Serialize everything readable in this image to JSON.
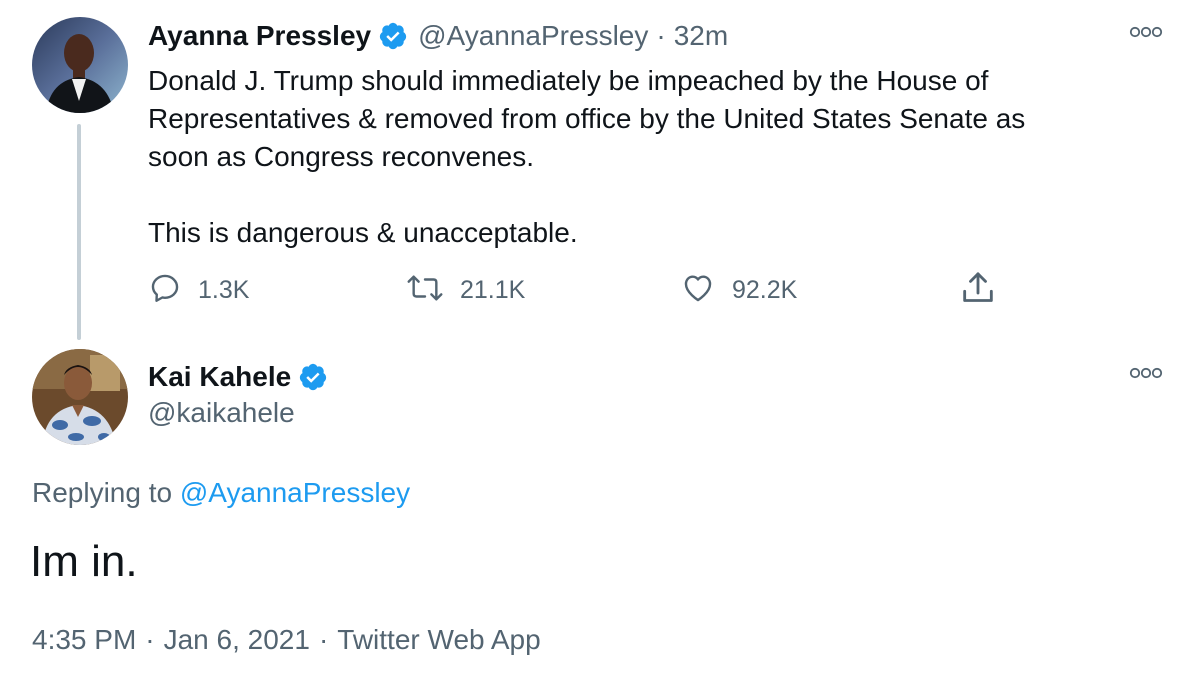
{
  "tweet1": {
    "display_name": "Ayanna Pressley",
    "handle": "@AyannaPressley",
    "separator": "·",
    "time_ago": "32m",
    "text_line1": "Donald J. Trump should immediately be impeached by the House of",
    "text_line2": "Representatives & removed from office by the United States Senate as",
    "text_line3": "soon as Congress reconvenes.",
    "text_line4": "This is dangerous & unacceptable.",
    "replies": "1.3K",
    "retweets": "21.1K",
    "likes": "92.2K"
  },
  "tweet2": {
    "display_name": "Kai Kahele",
    "handle": "@kaikahele",
    "replying_label": "Replying to",
    "replying_handle": "@AyannaPressley",
    "text": "Im in.",
    "time": "4:35 PM",
    "date": "Jan 6, 2021",
    "source": "Twitter Web App",
    "separator": "·"
  },
  "icons": {
    "verified": "verified-badge-icon",
    "more": "more-icon",
    "reply": "reply-icon",
    "retweet": "retweet-icon",
    "like": "heart-icon",
    "share": "share-icon"
  },
  "colors": {
    "verified_blue": "#1d9bf0",
    "link_blue": "#1d9bf0",
    "secondary_text": "#536471",
    "primary_text": "#0f1419",
    "thread_line": "#c4cfd6"
  }
}
